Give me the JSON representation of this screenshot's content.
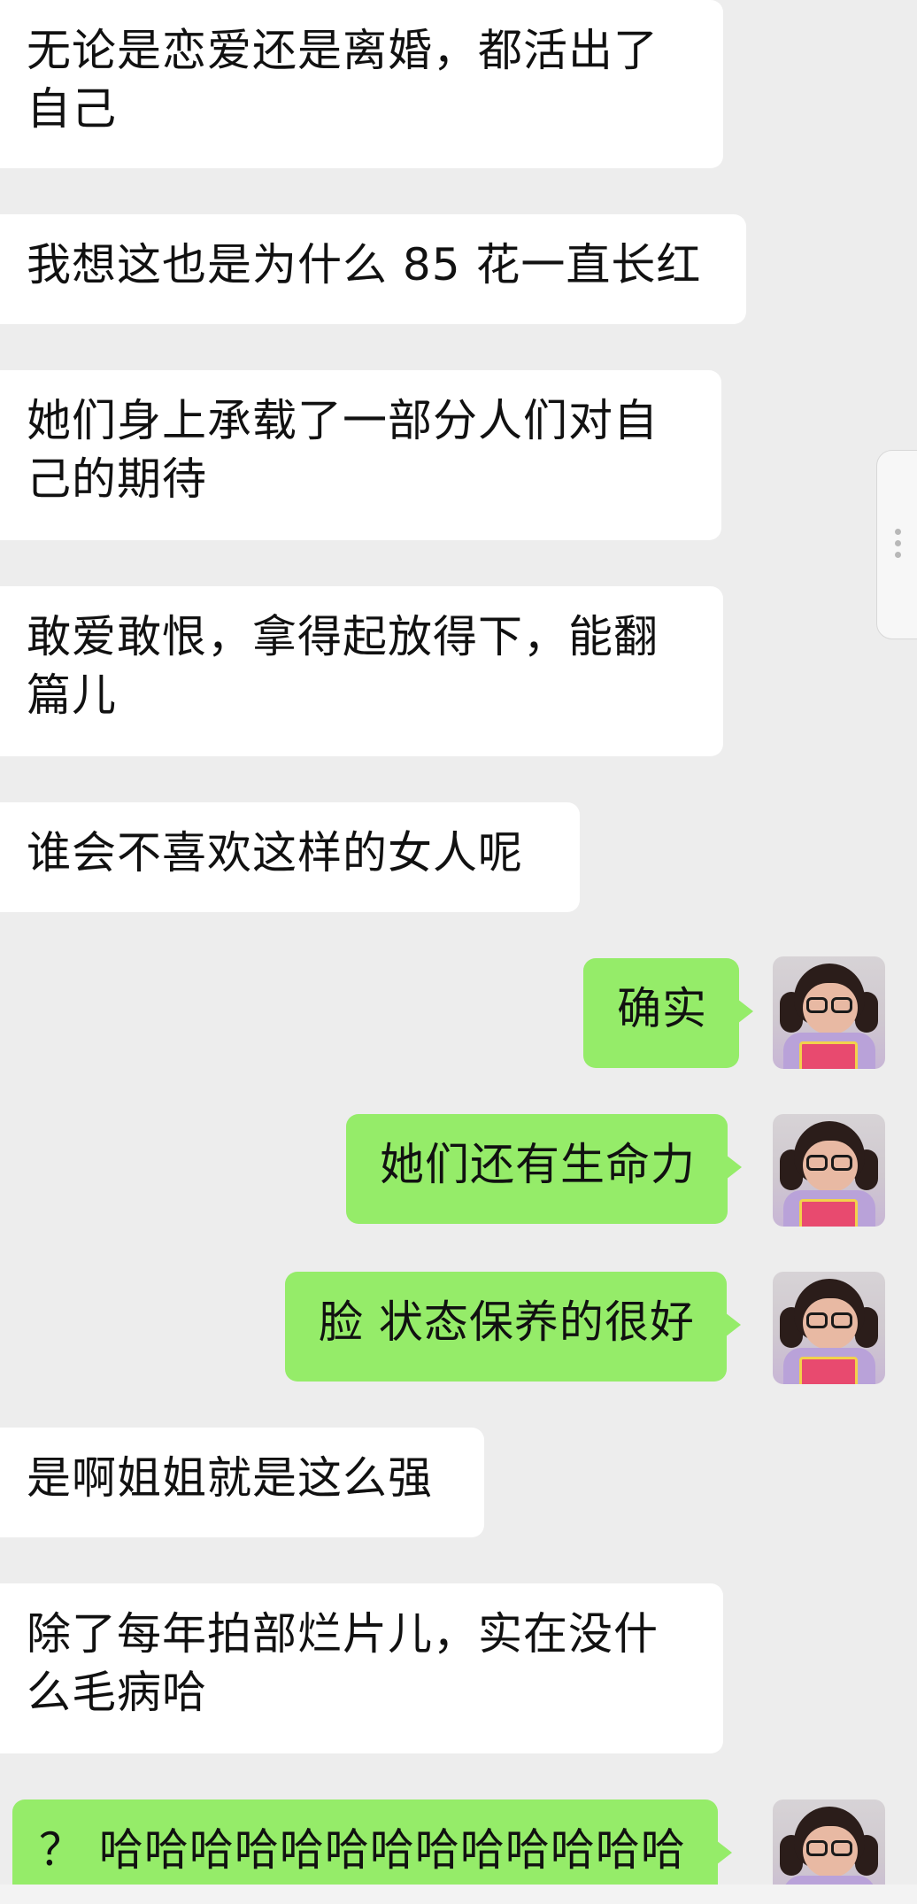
{
  "conversation": {
    "messages": [
      {
        "side": "left",
        "text": "无论是恋爱还是离婚，都活出了自己"
      },
      {
        "side": "left",
        "text": "我想这也是为什么 85 花一直长红"
      },
      {
        "side": "left",
        "text": "她们身上承载了一部分人们对自己的期待"
      },
      {
        "side": "left",
        "text": "敢爱敢恨，拿得起放得下，能翻篇儿"
      },
      {
        "side": "left",
        "text": "谁会不喜欢这样的女人呢"
      },
      {
        "side": "right",
        "text": "确实"
      },
      {
        "side": "right",
        "text": "她们还有生命力"
      },
      {
        "side": "right",
        "text": "脸 状态保养的很好"
      },
      {
        "side": "left",
        "text": "是啊姐姐就是这么强"
      },
      {
        "side": "left",
        "text": "除了每年拍部烂片儿，实在没什么毛病哈"
      },
      {
        "side": "right",
        "text": "？ 哈哈哈哈哈哈哈哈哈哈哈哈哈"
      }
    ]
  },
  "colors": {
    "background": "#ededed",
    "incoming_bubble": "#ffffff",
    "outgoing_bubble": "#95ec69"
  },
  "icons": {
    "avatar": "user-avatar-photo",
    "scroll_handle": "vertical-dots-icon"
  }
}
